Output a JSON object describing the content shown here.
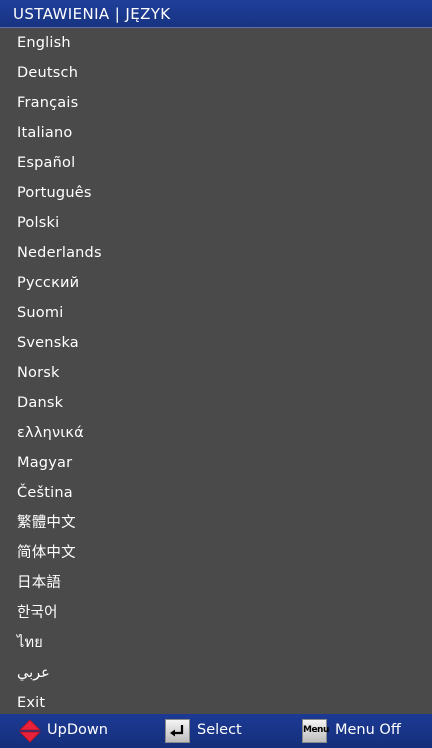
{
  "title": "USTAWIENIA | JĘZYK",
  "languages": [
    "English",
    "Deutsch",
    "Français",
    "Italiano",
    "Español",
    "Português",
    "Polski",
    "Nederlands",
    "Русский",
    "Suomi",
    "Svenska",
    "Norsk",
    "Dansk",
    "ελληνικά",
    "Magyar",
    "Čeština",
    "繁體中文",
    "简体中文",
    "日本語",
    "한국어",
    "ไทย",
    "عربي",
    "Exit"
  ],
  "footer": {
    "updown_label": "UpDown",
    "select_label": "Select",
    "menu_key_label": "Menu",
    "menuoff_label": "Menu Off"
  },
  "colors": {
    "title_bar": "#1f3f9a",
    "menu_background": "#4a4a4a",
    "footer_bar": "#1c3a95",
    "arrow_icon": "#e8223a"
  },
  "icons": {
    "updown": "updown-arrows-icon",
    "select": "enter-key-icon",
    "menu": "menu-key-icon"
  }
}
